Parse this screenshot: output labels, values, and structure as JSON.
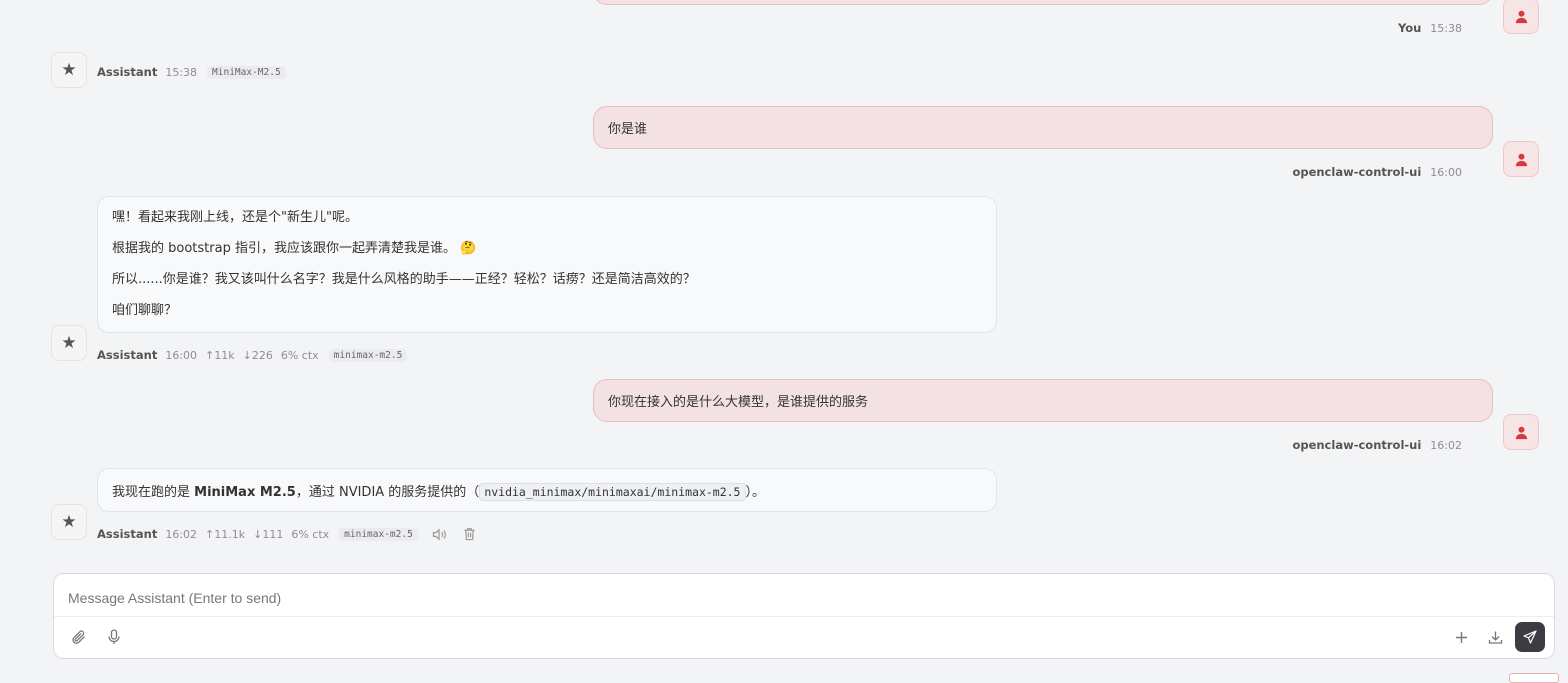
{
  "messages": [
    {
      "role": "user",
      "meta": {
        "sender": "You",
        "time": "15:38"
      }
    },
    {
      "role": "assistant",
      "meta": {
        "sender": "Assistant",
        "time": "15:38",
        "model": "MiniMax-M2.5"
      }
    },
    {
      "role": "user",
      "text": "你是谁",
      "meta": {
        "sender": "openclaw-control-ui",
        "time": "16:00"
      }
    },
    {
      "role": "assistant",
      "paragraphs": [
        "嘿！看起来我刚上线，还是个\"新生儿\"呢。",
        "根据我的 bootstrap 指引，我应该跟你一起弄清楚我是谁。",
        "所以......你是谁？我又该叫什么名字？我是什么风格的助手——正经？轻松？话痨？还是简洁高效的？",
        "咱们聊聊？"
      ],
      "emoji": "🤔",
      "meta": {
        "sender": "Assistant",
        "time": "16:00",
        "tokens_up": "↑11k",
        "tokens_down": "↓226",
        "ctx": "6% ctx",
        "model": "minimax-m2.5"
      }
    },
    {
      "role": "user",
      "text": "你现在接入的是什么大模型，是谁提供的服务",
      "meta": {
        "sender": "openclaw-control-ui",
        "time": "16:02"
      }
    },
    {
      "role": "assistant",
      "parts": {
        "prefix": "我现在跑的是 ",
        "bold": "MiniMax M2.5",
        "middle": "，通过 NVIDIA 的服务提供的（",
        "code": "nvidia_minimax/minimaxai/minimax-m2.5",
        "suffix": "）。"
      },
      "meta": {
        "sender": "Assistant",
        "time": "16:02",
        "tokens_up": "↑11.1k",
        "tokens_down": "↓111",
        "ctx": "6% ctx",
        "model": "minimax-m2.5"
      }
    }
  ],
  "composer": {
    "placeholder": "Message Assistant (Enter to send)",
    "value": ""
  },
  "icons": {
    "assistant_avatar": "star-icon",
    "user_avatar": "person-icon",
    "attach": "paperclip-icon",
    "mic": "microphone-icon",
    "new": "plus-icon",
    "export": "download-icon",
    "send": "send-icon",
    "speak": "speaker-icon",
    "delete": "trash-icon"
  },
  "colors": {
    "user_bubble": "#f3e1e3",
    "user_bubble_border": "#e8bcc1",
    "user_icon": "#d63a3a",
    "send_button": "#3b3d42"
  }
}
